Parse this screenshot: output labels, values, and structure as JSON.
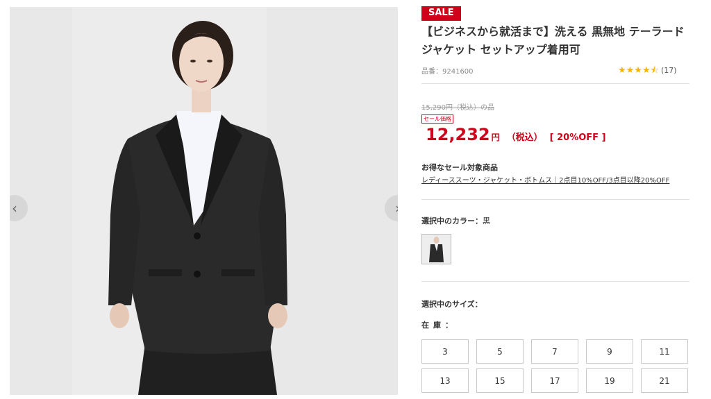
{
  "product": {
    "sale_badge": "SALE",
    "title": "【ビジネスから就活まで】洗える 黒無地 テーラードジャケット セットアップ着用可",
    "code": "品番：9241600",
    "rating_stars": "★★★★⯪",
    "rating_count": "(17)",
    "original_price": "15,290円（税込）の品",
    "sale_label": "セール価格",
    "price_value": "12,232",
    "price_unit": "円",
    "price_tax": "（税込）",
    "discount": "[ 20%OFF ]",
    "campaign_title": "お得なセール対象商品",
    "campaign_link": "レディーススーツ・ジャケット・ボトムス｜2点目10%OFF/3点目以降20%OFF",
    "color_label": "選択中のカラー：",
    "color_value": "黒",
    "size_label": "選択中のサイズ：",
    "stock_label": "在庫："
  },
  "gallery": {
    "prev_icon": "‹",
    "next_icon": "›"
  },
  "sizes": [
    "3",
    "5",
    "7",
    "9",
    "11",
    "13",
    "15",
    "17",
    "19",
    "21"
  ],
  "colors": {
    "accent": "#d0021b",
    "star": "#f5b400"
  }
}
